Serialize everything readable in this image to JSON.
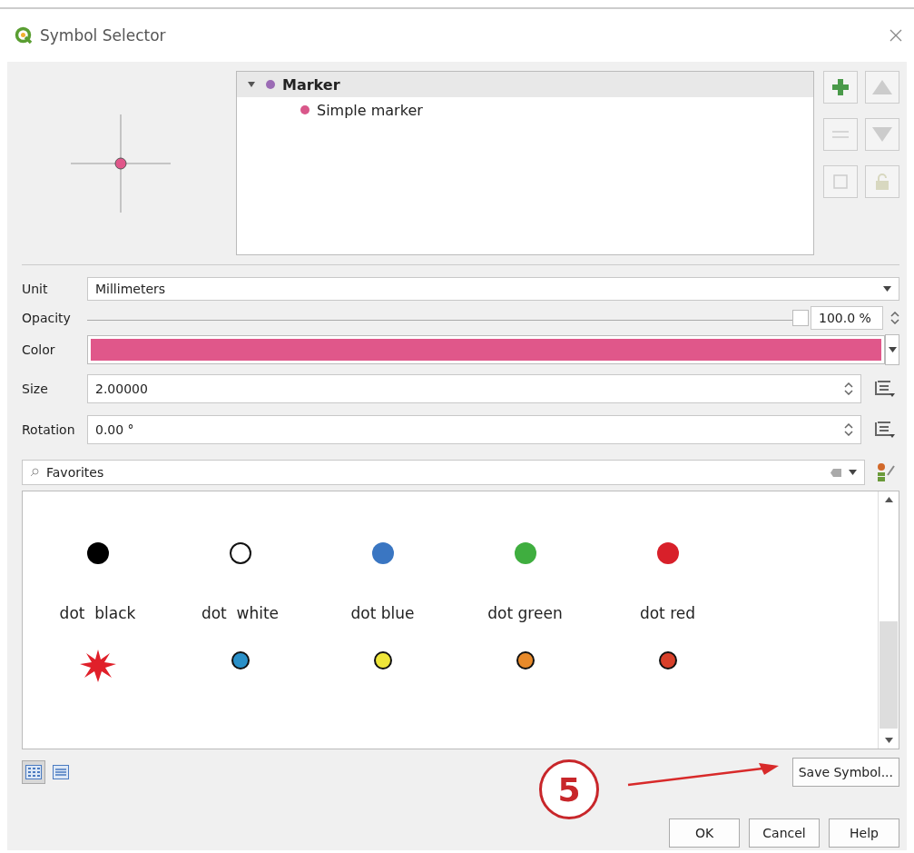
{
  "window": {
    "title": "Symbol Selector"
  },
  "tree": [
    {
      "label": "Marker",
      "color": "#9b6bb5",
      "expanded": true,
      "selected": true,
      "children": [
        {
          "label": "Simple marker",
          "color": "#d9578a",
          "selected": false
        }
      ]
    }
  ],
  "fields": [
    {
      "kind": "combo",
      "label": "Unit",
      "value": "Millimeters"
    },
    {
      "kind": "slider",
      "label": "Opacity",
      "level": 1.0,
      "value": "100.0 %"
    },
    {
      "kind": "color",
      "label": "Color",
      "color": "#e0578a"
    },
    {
      "kind": "spin",
      "label": "Size",
      "value": "2.00000"
    },
    {
      "kind": "spin",
      "label": "Rotation",
      "value": "0.00 °"
    }
  ],
  "search": {
    "value": "Favorites"
  },
  "symbols": [
    {
      "kind": "dot",
      "name": "dot  black",
      "color": "#000000"
    },
    {
      "kind": "ring",
      "name": "dot  white",
      "color": "#ffffff"
    },
    {
      "kind": "dot",
      "name": "dot blue",
      "color": "#3a76c2"
    },
    {
      "kind": "dot",
      "name": "dot green",
      "color": "#3fae3f"
    },
    {
      "kind": "dot",
      "name": "dot red",
      "color": "#d8202a"
    },
    {
      "kind": "star",
      "color": "#e0202a"
    },
    {
      "kind": "outlined",
      "color": "#2a90c8"
    },
    {
      "kind": "outlined",
      "color": "#efe63a"
    },
    {
      "kind": "outlined",
      "color": "#e88a2a"
    },
    {
      "kind": "outlined",
      "color": "#d8402a"
    }
  ],
  "view_modes": [
    {
      "kind": "icons",
      "selected": true
    },
    {
      "kind": "list",
      "selected": false
    }
  ],
  "save_button": "Save Symbol...",
  "annotation": {
    "label": "5"
  },
  "buttons": [
    "OK",
    "Cancel",
    "Help"
  ]
}
